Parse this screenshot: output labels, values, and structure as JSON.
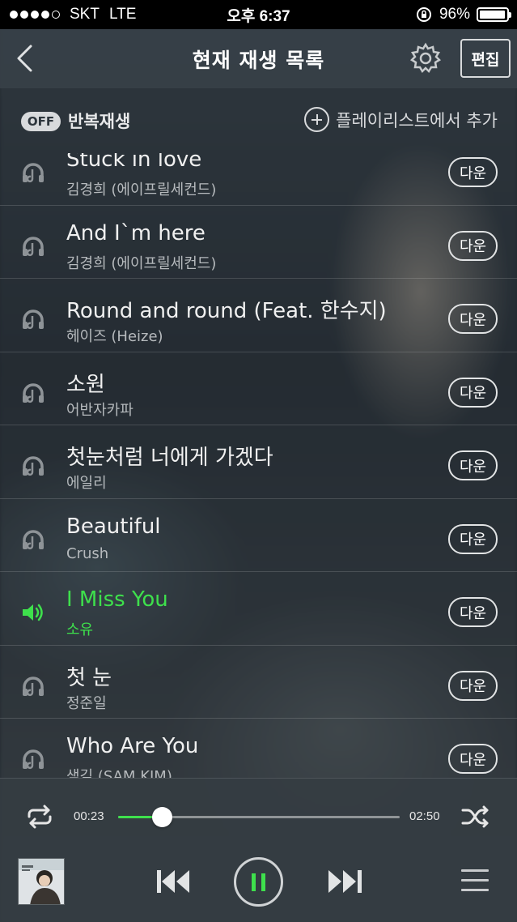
{
  "status_bar": {
    "carrier": "SKT",
    "network": "LTE",
    "time": "오후 6:37",
    "battery": "96%",
    "battery_level": 0.96
  },
  "header": {
    "title": "현재 재생 목록",
    "edit_label": "편집"
  },
  "controls": {
    "repeat_state": "OFF",
    "repeat_label": "반복재생",
    "add_playlist_label": "플레이리스트에서 추가"
  },
  "songs": [
    {
      "title": "Stuck in love",
      "artist": "김경희 (에이프릴세컨드)",
      "button": "다운",
      "playing": false
    },
    {
      "title": "And I`m here",
      "artist": "김경희 (에이프릴세컨드)",
      "button": "다운",
      "playing": false
    },
    {
      "title": "Round and round (Feat. 한수지)",
      "artist": "헤이즈 (Heize)",
      "button": "다운",
      "playing": false
    },
    {
      "title": "소원",
      "artist": "어반자카파",
      "button": "다운",
      "playing": false
    },
    {
      "title": "첫눈처럼 너에게 가겠다",
      "artist": "에일리",
      "button": "다운",
      "playing": false
    },
    {
      "title": "Beautiful",
      "artist": "Crush",
      "button": "다운",
      "playing": false
    },
    {
      "title": "I Miss You",
      "artist": "소유",
      "button": "다운",
      "playing": true
    },
    {
      "title": "첫 눈",
      "artist": "정준일",
      "button": "다운",
      "playing": false
    },
    {
      "title": "Who Are You",
      "artist": "샘김 (SAM KIM)",
      "button": "다운",
      "playing": false
    }
  ],
  "player": {
    "current_time": "00:23",
    "duration": "02:50",
    "progress": 0.155
  },
  "colors": {
    "accent": "#3ee04c",
    "header_bg": "#374048"
  },
  "icons": {
    "back": "back-chevron-icon",
    "settings": "gear-icon",
    "song": "headphone-icon",
    "playing": "speaker-icon",
    "repeat": "repeat-icon",
    "shuffle": "shuffle-icon",
    "prev": "skip-previous-icon",
    "pause": "pause-icon",
    "next": "skip-next-icon",
    "menu": "hamburger-menu-icon"
  }
}
